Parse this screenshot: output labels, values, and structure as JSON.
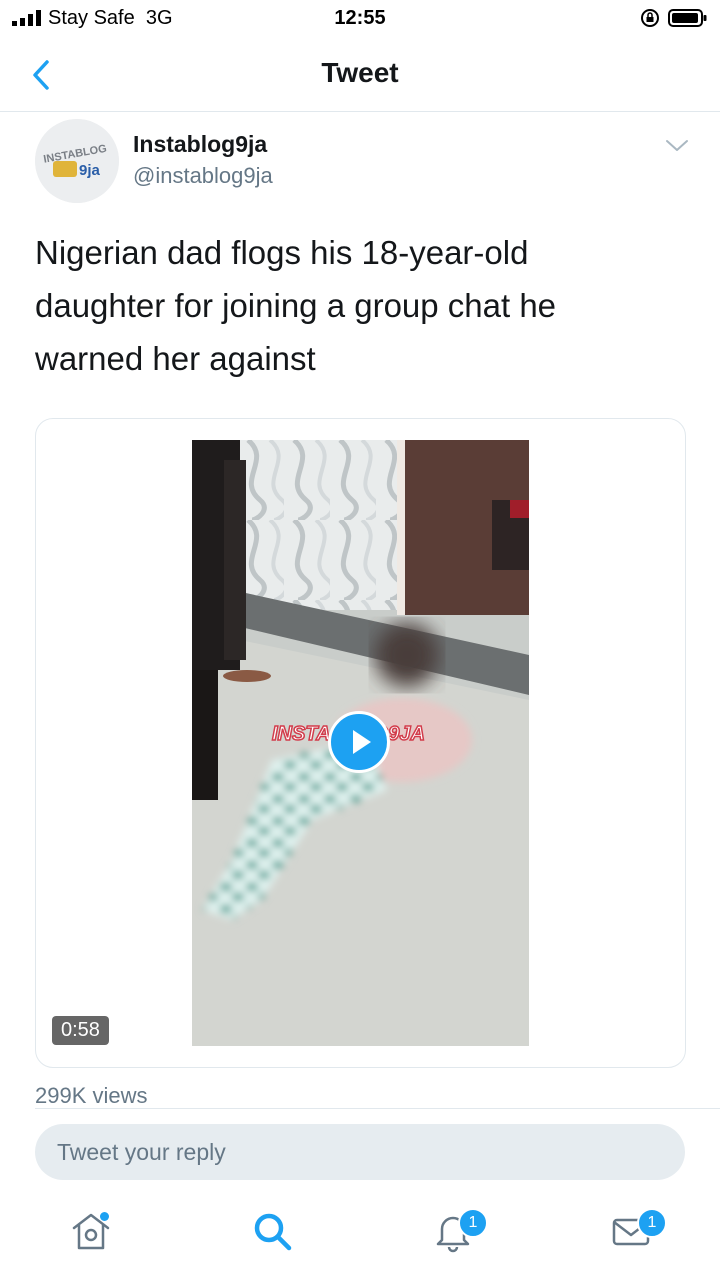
{
  "status_bar": {
    "carrier": "Stay Safe",
    "network": "3G",
    "time": "12:55"
  },
  "nav": {
    "title": "Tweet",
    "back_icon": "chevron-left-icon"
  },
  "tweet": {
    "author_name": "Instablog9ja",
    "author_handle": "@instablog9ja",
    "avatar_logo_text": "INSTABLOG 9ja",
    "text": "Nigerian dad flogs his 18-year-old daughter for joining a group chat he warned her against",
    "video": {
      "duration": "0:58",
      "watermark": "INSTABLOG9JA"
    },
    "views": "299K views"
  },
  "reply": {
    "placeholder": "Tweet your reply"
  },
  "tabbar": {
    "home_icon": "home-icon",
    "search_icon": "search-icon",
    "notifications_icon": "bell-icon",
    "notifications_badge": "1",
    "messages_icon": "mail-icon",
    "messages_badge": "1"
  },
  "colors": {
    "accent": "#1da1f2",
    "text_primary": "#14171a",
    "text_secondary": "#657786",
    "border": "#e1e8ed"
  }
}
